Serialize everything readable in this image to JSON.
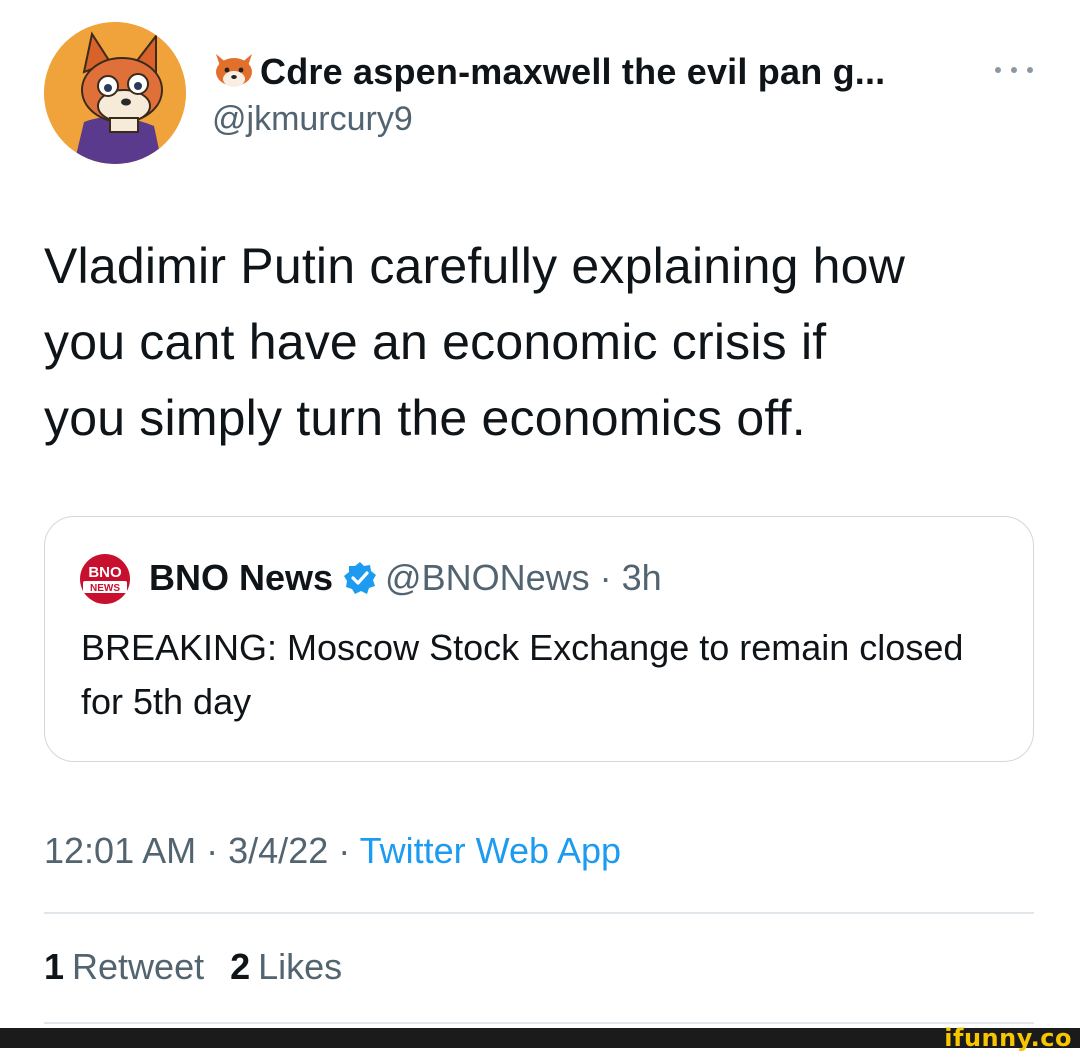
{
  "tweet": {
    "author": {
      "display_name": "Cdre aspen-maxwell the evil pan g...",
      "handle": "@jkmurcury9",
      "name_emoji": "fox-face-icon",
      "avatar": "avatar-fox-illustration"
    },
    "text": "Vladimir Putin carefully explaining how\nyou cant have an economic crisis if\nyou simply turn the economics off.",
    "quoted": {
      "author_name": "BNO News",
      "handle": "@BNONews",
      "separator": "·",
      "time": "3h",
      "text": "BREAKING: Moscow Stock Exchange to remain closed for 5th day",
      "logo": "bno-news-logo"
    },
    "meta": {
      "time": "12:01 AM",
      "sep1": "·",
      "date": "3/4/22",
      "sep2": "·",
      "source": "Twitter Web App"
    },
    "stats": {
      "retweets_count": "1",
      "retweets_label": "Retweet",
      "likes_count": "2",
      "likes_label": "Likes"
    }
  },
  "watermark": "ifunny.co",
  "colors": {
    "text": "#0f1419",
    "secondary": "#536471",
    "link": "#1d9bf0",
    "verified": "#1d9bf0",
    "border": "#cfd9de",
    "watermark": "#f7c600"
  }
}
